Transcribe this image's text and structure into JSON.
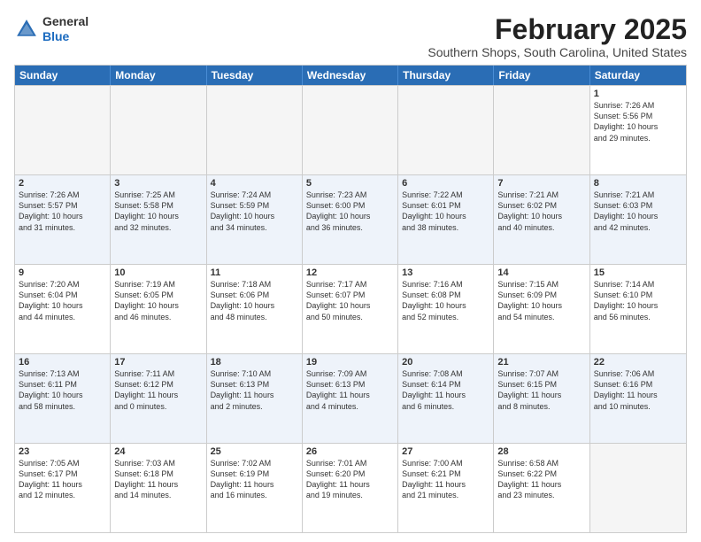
{
  "logo": {
    "general": "General",
    "blue": "Blue"
  },
  "title": "February 2025",
  "location": "Southern Shops, South Carolina, United States",
  "days_of_week": [
    "Sunday",
    "Monday",
    "Tuesday",
    "Wednesday",
    "Thursday",
    "Friday",
    "Saturday"
  ],
  "rows": [
    [
      {
        "day": "",
        "text": "",
        "empty": true
      },
      {
        "day": "",
        "text": "",
        "empty": true
      },
      {
        "day": "",
        "text": "",
        "empty": true
      },
      {
        "day": "",
        "text": "",
        "empty": true
      },
      {
        "day": "",
        "text": "",
        "empty": true
      },
      {
        "day": "",
        "text": "",
        "empty": true
      },
      {
        "day": "1",
        "text": "Sunrise: 7:26 AM\nSunset: 5:56 PM\nDaylight: 10 hours\nand 29 minutes."
      }
    ],
    [
      {
        "day": "2",
        "text": "Sunrise: 7:26 AM\nSunset: 5:57 PM\nDaylight: 10 hours\nand 31 minutes."
      },
      {
        "day": "3",
        "text": "Sunrise: 7:25 AM\nSunset: 5:58 PM\nDaylight: 10 hours\nand 32 minutes."
      },
      {
        "day": "4",
        "text": "Sunrise: 7:24 AM\nSunset: 5:59 PM\nDaylight: 10 hours\nand 34 minutes."
      },
      {
        "day": "5",
        "text": "Sunrise: 7:23 AM\nSunset: 6:00 PM\nDaylight: 10 hours\nand 36 minutes."
      },
      {
        "day": "6",
        "text": "Sunrise: 7:22 AM\nSunset: 6:01 PM\nDaylight: 10 hours\nand 38 minutes."
      },
      {
        "day": "7",
        "text": "Sunrise: 7:21 AM\nSunset: 6:02 PM\nDaylight: 10 hours\nand 40 minutes."
      },
      {
        "day": "8",
        "text": "Sunrise: 7:21 AM\nSunset: 6:03 PM\nDaylight: 10 hours\nand 42 minutes."
      }
    ],
    [
      {
        "day": "9",
        "text": "Sunrise: 7:20 AM\nSunset: 6:04 PM\nDaylight: 10 hours\nand 44 minutes."
      },
      {
        "day": "10",
        "text": "Sunrise: 7:19 AM\nSunset: 6:05 PM\nDaylight: 10 hours\nand 46 minutes."
      },
      {
        "day": "11",
        "text": "Sunrise: 7:18 AM\nSunset: 6:06 PM\nDaylight: 10 hours\nand 48 minutes."
      },
      {
        "day": "12",
        "text": "Sunrise: 7:17 AM\nSunset: 6:07 PM\nDaylight: 10 hours\nand 50 minutes."
      },
      {
        "day": "13",
        "text": "Sunrise: 7:16 AM\nSunset: 6:08 PM\nDaylight: 10 hours\nand 52 minutes."
      },
      {
        "day": "14",
        "text": "Sunrise: 7:15 AM\nSunset: 6:09 PM\nDaylight: 10 hours\nand 54 minutes."
      },
      {
        "day": "15",
        "text": "Sunrise: 7:14 AM\nSunset: 6:10 PM\nDaylight: 10 hours\nand 56 minutes."
      }
    ],
    [
      {
        "day": "16",
        "text": "Sunrise: 7:13 AM\nSunset: 6:11 PM\nDaylight: 10 hours\nand 58 minutes."
      },
      {
        "day": "17",
        "text": "Sunrise: 7:11 AM\nSunset: 6:12 PM\nDaylight: 11 hours\nand 0 minutes."
      },
      {
        "day": "18",
        "text": "Sunrise: 7:10 AM\nSunset: 6:13 PM\nDaylight: 11 hours\nand 2 minutes."
      },
      {
        "day": "19",
        "text": "Sunrise: 7:09 AM\nSunset: 6:13 PM\nDaylight: 11 hours\nand 4 minutes."
      },
      {
        "day": "20",
        "text": "Sunrise: 7:08 AM\nSunset: 6:14 PM\nDaylight: 11 hours\nand 6 minutes."
      },
      {
        "day": "21",
        "text": "Sunrise: 7:07 AM\nSunset: 6:15 PM\nDaylight: 11 hours\nand 8 minutes."
      },
      {
        "day": "22",
        "text": "Sunrise: 7:06 AM\nSunset: 6:16 PM\nDaylight: 11 hours\nand 10 minutes."
      }
    ],
    [
      {
        "day": "23",
        "text": "Sunrise: 7:05 AM\nSunset: 6:17 PM\nDaylight: 11 hours\nand 12 minutes."
      },
      {
        "day": "24",
        "text": "Sunrise: 7:03 AM\nSunset: 6:18 PM\nDaylight: 11 hours\nand 14 minutes."
      },
      {
        "day": "25",
        "text": "Sunrise: 7:02 AM\nSunset: 6:19 PM\nDaylight: 11 hours\nand 16 minutes."
      },
      {
        "day": "26",
        "text": "Sunrise: 7:01 AM\nSunset: 6:20 PM\nDaylight: 11 hours\nand 19 minutes."
      },
      {
        "day": "27",
        "text": "Sunrise: 7:00 AM\nSunset: 6:21 PM\nDaylight: 11 hours\nand 21 minutes."
      },
      {
        "day": "28",
        "text": "Sunrise: 6:58 AM\nSunset: 6:22 PM\nDaylight: 11 hours\nand 23 minutes."
      },
      {
        "day": "",
        "text": "",
        "empty": true
      }
    ]
  ]
}
